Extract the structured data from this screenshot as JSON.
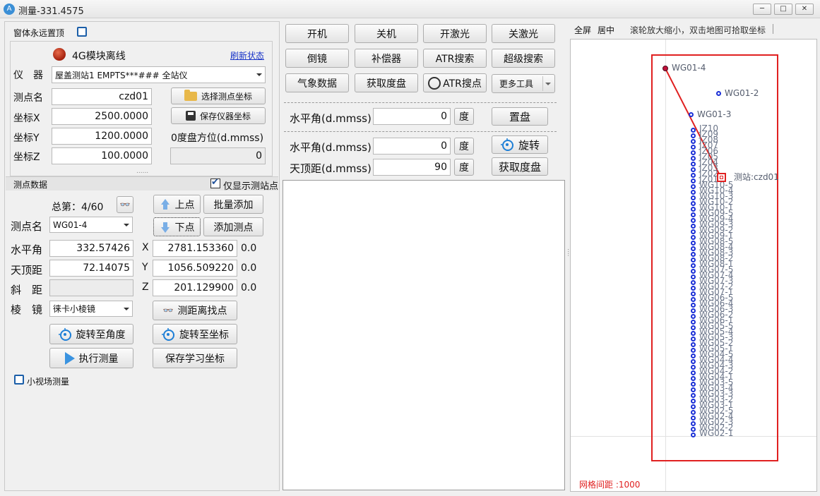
{
  "window": {
    "title": "测量-331.4575",
    "icon": "app-icon",
    "minimize": "─",
    "maximize": "□",
    "close": "✕"
  },
  "top": {
    "always_on_top": "窗体永远置顶",
    "module_status": "4G模块离线",
    "refresh": "刷新状态"
  },
  "instrument": {
    "label": "仪　器",
    "value": "屋盖测站1 EMPTS***### 全站仪"
  },
  "station": {
    "name_label": "测点名",
    "name_value": "czd01",
    "select_btn": "选择测点坐标",
    "x_label": "坐标X",
    "x_value": "2500.0000",
    "save_btn": "保存仪器坐标",
    "y_label": "坐标Y",
    "y_value": "1200.0000",
    "azimuth_label": "0度盘方位(d.mmss)",
    "z_label": "坐标Z",
    "z_value": "100.0000",
    "azimuth_value": "0"
  },
  "points": {
    "section_title": "测点数据",
    "only_show_station": "仅显示测站点",
    "total_label": "总第：4/60",
    "prev_btn": "上点",
    "batch_add_btn": "批量添加",
    "next_btn": "下点",
    "add_point_btn": "添加测点",
    "name_label": "测点名",
    "name_value": "WG01-4",
    "h_label": "水平角",
    "h_value": "332.57426",
    "x_label": "X",
    "x_value": "2781.153360",
    "x_dev": "0.0",
    "v_label": "天顶距",
    "v_value": "72.14075",
    "y_label": "Y",
    "y_value": "1056.509220",
    "y_dev": "0.0",
    "d_label": "斜　距",
    "d_value": "",
    "z_label": "Z",
    "z_value": "201.129900",
    "z_dev": "0.0",
    "prism_label": "棱　镜",
    "prism_value": "徕卡小棱镜",
    "range_btn": "测距离找点",
    "rotate_angle_btn": "旋转至角度",
    "rotate_coord_btn": "旋转至坐标",
    "measure_btn": "执行测量",
    "save_learn_btn": "保存学习坐标",
    "small_fov": "小视场测量"
  },
  "controls": {
    "row1": [
      "开机",
      "关机",
      "开激光",
      "关激光"
    ],
    "row2": [
      "倒镜",
      "补偿器",
      "ATR搜索",
      "超级搜索"
    ],
    "row3": [
      "气象数据",
      "获取度盘",
      "ATR搜点",
      "更多工具"
    ],
    "set_h_label": "水平角(d.mmss)",
    "set_h_value": "0",
    "deg1": "度",
    "set_btn": "置盘",
    "rot_h_label": "水平角(d.mmss)",
    "rot_h_value": "0",
    "deg2": "度",
    "rotate_btn": "旋转",
    "rot_v_label": "天顶距(d.mmss)",
    "rot_v_value": "90",
    "deg3": "度",
    "get_disk_btn": "获取度盘"
  },
  "map": {
    "fullscreen": "全屏",
    "center": "居中",
    "hint": "滚轮放大缩小，双击地图可拾取坐标",
    "grid_label": "网格间距 :1000",
    "labels": {
      "wg014": "WG01-4",
      "wg012": "WG01-2",
      "wg013": "WG01-3",
      "station": "测站:czd01"
    },
    "stack_labels": [
      "JZ10",
      "JZ09",
      "JZ08",
      "JZ07",
      "JZ06",
      "JZ05",
      "JZ04",
      "JZ03",
      "JZ02",
      "JZ01",
      "WG10-5",
      "WG10-4",
      "WG10-3",
      "WG10-2",
      "WG10-1",
      "WG09-5",
      "WG09-4",
      "WG09-3",
      "WG09-2",
      "WG09-1",
      "WG08-5",
      "WG08-4",
      "WG08-3",
      "WG08-2",
      "WG08-1",
      "WG07-5",
      "WG07-4",
      "WG07-3",
      "WG07-2",
      "WG07-1",
      "WG06-5",
      "WG06-4",
      "WG06-3",
      "WG06-2",
      "WG06-1",
      "WG05-5",
      "WG05-4",
      "WG05-3",
      "WG05-2",
      "WG05-1",
      "WG04-5",
      "WG04-4",
      "WG04-3",
      "WG04-2",
      "WG04-1",
      "WG03-5",
      "WG03-4",
      "WG03-3",
      "WG03-2",
      "WG03-1",
      "WG02-5",
      "WG02-4",
      "WG02-3",
      "WG02-2",
      "WG02-1"
    ],
    "colors": {
      "frame": "#e02020",
      "point": "#1a2fd6",
      "label": "#6a7488",
      "selected": "#c0103a"
    }
  }
}
